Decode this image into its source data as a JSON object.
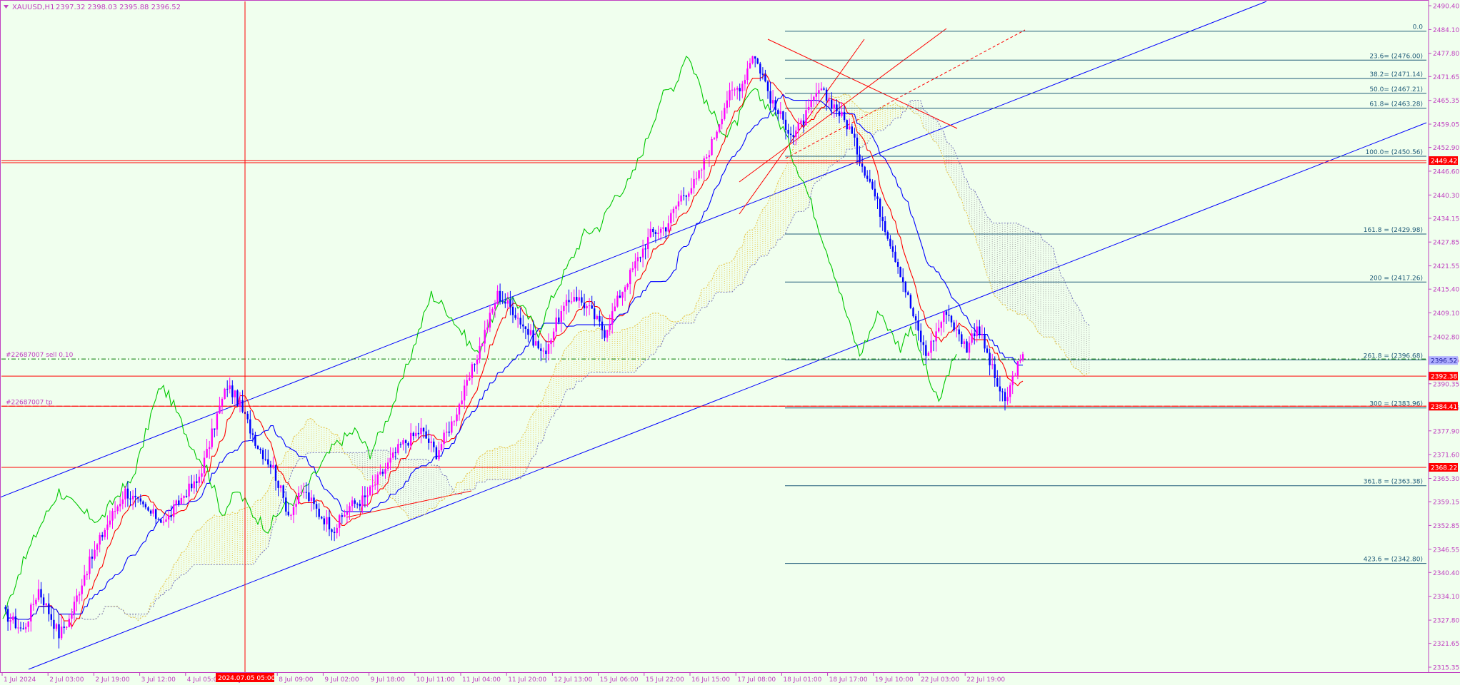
{
  "header": {
    "symbol": "XAUUSD,H1",
    "ohlc": "2397.32 2398.03 2395.88 2396.52"
  },
  "colors": {
    "bg": "#f0ffee",
    "axis": "#c040c0",
    "bull": "#ff00ff",
    "bear": "#0000ff",
    "tenkan": "#ff0000",
    "kijun": "#0000ff",
    "chikou": "#00c800",
    "kumo_up": "#e6c850",
    "kumo_down": "#a0a0a0",
    "fibo": "#1e5a78",
    "channel": "#0000ff",
    "hline": "#ff0000",
    "order": "#007a00"
  },
  "chart_data": {
    "type": "candlestick",
    "symbol": "XAUUSD",
    "timeframe": "H1",
    "ylim": [
      2315.25,
      2493.5
    ],
    "y_ticks": [
      "2490.40",
      "2484.10",
      "2477.80",
      "2471.65",
      "2465.35",
      "2459.05",
      "2452.90",
      "2446.60",
      "2440.30",
      "2434.15",
      "2427.85",
      "2421.55",
      "2415.40",
      "2409.10",
      "2402.80",
      "2396.65",
      "2390.35",
      "2384.05",
      "2377.90",
      "2371.60",
      "2365.30",
      "2359.15",
      "2352.85",
      "2346.55",
      "2340.40",
      "2334.10",
      "2327.80",
      "2321.65",
      "2315.35"
    ],
    "x_ticks": [
      "1 Jul 2024",
      "2 Jul 03:00",
      "2 Jul 19:00",
      "3 Jul 12:00",
      "4 Jul 05:00",
      "5 Jul 16:00",
      "8 Jul 09:00",
      "9 Jul 02:00",
      "9 Jul 18:00",
      "10 Jul 11:00",
      "11 Jul 04:00",
      "11 Jul 20:00",
      "12 Jul 13:00",
      "15 Jul 06:00",
      "15 Jul 22:00",
      "16 Jul 15:00",
      "17 Jul 08:00",
      "18 Jul 01:00",
      "18 Jul 17:00",
      "19 Jul 10:00",
      "22 Jul 03:00",
      "22 Jul 19:00"
    ],
    "crosshair_time": "2024.07.05 05:00",
    "price_path": [
      [
        0,
        2330
      ],
      [
        8,
        2325
      ],
      [
        14,
        2336
      ],
      [
        22,
        2324
      ],
      [
        26,
        2328
      ],
      [
        32,
        2340
      ],
      [
        40,
        2352
      ],
      [
        48,
        2362
      ],
      [
        54,
        2358
      ],
      [
        58,
        2356
      ],
      [
        64,
        2354
      ],
      [
        68,
        2358
      ],
      [
        72,
        2362
      ],
      [
        76,
        2364
      ],
      [
        80,
        2372
      ],
      [
        84,
        2382
      ],
      [
        88,
        2390
      ],
      [
        92,
        2386
      ],
      [
        96,
        2380
      ],
      [
        100,
        2374
      ],
      [
        106,
        2368
      ],
      [
        112,
        2356
      ],
      [
        118,
        2362
      ],
      [
        124,
        2356
      ],
      [
        130,
        2352
      ],
      [
        136,
        2358
      ],
      [
        142,
        2360
      ],
      [
        148,
        2366
      ],
      [
        156,
        2374
      ],
      [
        164,
        2378
      ],
      [
        170,
        2372
      ],
      [
        176,
        2380
      ],
      [
        182,
        2390
      ],
      [
        188,
        2402
      ],
      [
        194,
        2414
      ],
      [
        200,
        2410
      ],
      [
        206,
        2404
      ],
      [
        212,
        2398
      ],
      [
        218,
        2408
      ],
      [
        224,
        2414
      ],
      [
        230,
        2410
      ],
      [
        236,
        2404
      ],
      [
        242,
        2414
      ],
      [
        248,
        2422
      ],
      [
        254,
        2430
      ],
      [
        260,
        2432
      ],
      [
        266,
        2440
      ],
      [
        272,
        2444
      ],
      [
        278,
        2454
      ],
      [
        284,
        2466
      ],
      [
        290,
        2470
      ],
      [
        294,
        2478
      ],
      [
        298,
        2472
      ],
      [
        302,
        2464
      ],
      [
        306,
        2460
      ],
      [
        310,
        2456
      ],
      [
        314,
        2460
      ],
      [
        320,
        2468
      ],
      [
        326,
        2464
      ],
      [
        332,
        2458
      ],
      [
        336,
        2450
      ],
      [
        340,
        2444
      ],
      [
        346,
        2432
      ],
      [
        352,
        2420
      ],
      [
        358,
        2406
      ],
      [
        362,
        2398
      ],
      [
        366,
        2404
      ],
      [
        370,
        2410
      ],
      [
        374,
        2404
      ],
      [
        378,
        2400
      ],
      [
        382,
        2406
      ],
      [
        386,
        2398
      ],
      [
        390,
        2390
      ],
      [
        393,
        2385
      ],
      [
        397,
        2394
      ],
      [
        400,
        2397
      ]
    ],
    "hlines": [
      {
        "price": 2449.42,
        "label": "2449.42"
      },
      {
        "price": 2392.38,
        "label": "2392.38"
      },
      {
        "price": 2384.41,
        "label": "2384.41"
      },
      {
        "price": 2368.22,
        "label": "2368.22"
      }
    ],
    "current_price": {
      "price": 2396.52,
      "label": "2396.52"
    },
    "order_lines": [
      {
        "price": 2396.9,
        "label": "#22687007 sell 0.10"
      },
      {
        "price": 2384.41,
        "label": "#22687007 tp"
      }
    ],
    "fibo": [
      {
        "price": 2483.65,
        "label": "0.0"
      },
      {
        "price": 2476.0,
        "label": "23.6= (2476.00)"
      },
      {
        "price": 2471.14,
        "label": "38.2= (2471.14)"
      },
      {
        "price": 2467.21,
        "label": "50.0= (2467.21)"
      },
      {
        "price": 2463.28,
        "label": "61.8= (2463.28)"
      },
      {
        "price": 2450.56,
        "label": "100.0= (2450.56)"
      },
      {
        "price": 2429.98,
        "label": "161.8 = (2429.98)"
      },
      {
        "price": 2417.26,
        "label": "200 = (2417.26)"
      },
      {
        "price": 2396.68,
        "label": "261.8 = (2396.68)"
      },
      {
        "price": 2383.96,
        "label": "300 = (2383.96)"
      },
      {
        "price": 2363.38,
        "label": "361.8 = (2363.38)"
      },
      {
        "price": 2342.8,
        "label": "423.6 = (2342.80)"
      }
    ]
  }
}
